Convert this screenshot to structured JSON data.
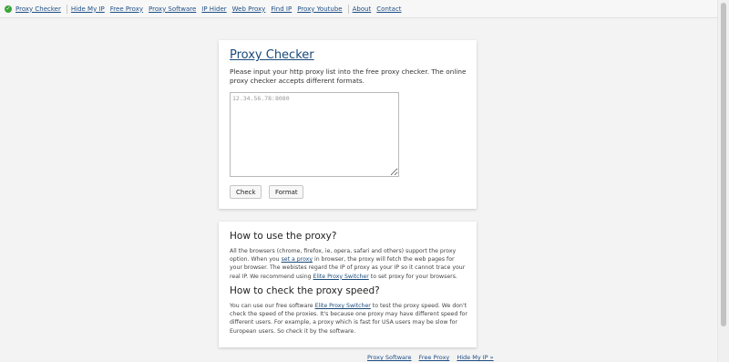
{
  "nav": {
    "items": [
      "Proxy Checker",
      "Hide My IP",
      "Free Proxy",
      "Proxy Software",
      "IP Hider",
      "Web Proxy",
      "Find IP",
      "Proxy Youtube",
      "About",
      "Contact"
    ]
  },
  "checker": {
    "title": "Proxy Checker",
    "description": "Please input your http proxy list into the free proxy checker. The online proxy checker accepts different formats.",
    "placeholder": "12.34.56.78:8080",
    "check_label": "Check",
    "format_label": "Format"
  },
  "info": {
    "h1": "How to use the proxy?",
    "p1_before": "All the browsers (chrome, firefox, ie, opera, safari and others) support the proxy option. When you ",
    "p1_link1": "set a proxy",
    "p1_middle": " in browser, the proxy will fetch the web pages for your browser. The webistes regard the IP of proxy as your IP so it cannot trace your real IP. We recommend using ",
    "p1_link2": "Elite Proxy Switcher",
    "p1_after": " to set proxy for your browsers.",
    "h2": "How to check the proxy speed?",
    "p2_before": "You can use our free software ",
    "p2_link": "Elite Proxy Switcher",
    "p2_after": " to test the proxy speed. We don't check the speed of the proxies. It's because one proxy may have different speed for different users. For example, a proxy which is fast for USA users may be slow for European users. So check it by the software."
  },
  "footer": {
    "links": [
      "Proxy Software",
      "Free Proxy",
      "Hide My IP »"
    ]
  }
}
